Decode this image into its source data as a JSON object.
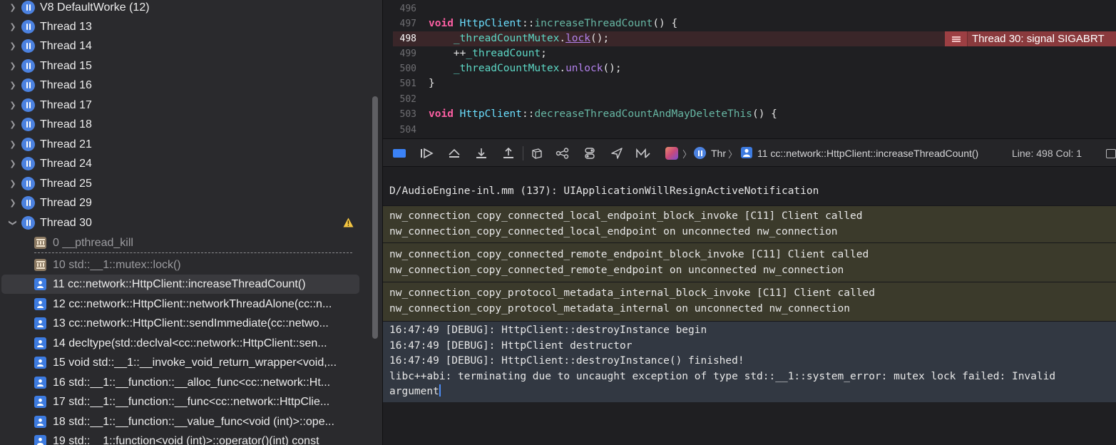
{
  "navigator": {
    "threads": [
      {
        "label": "V8 DefaultWorke (12)"
      },
      {
        "label": "Thread 13"
      },
      {
        "label": "Thread 14"
      },
      {
        "label": "Thread 15"
      },
      {
        "label": "Thread 16"
      },
      {
        "label": "Thread 17"
      },
      {
        "label": "Thread 18"
      },
      {
        "label": "Thread 21"
      },
      {
        "label": "Thread 24"
      },
      {
        "label": "Thread 25"
      },
      {
        "label": "Thread 29"
      },
      {
        "label": "Thread 30",
        "expanded": true,
        "warning": true
      }
    ],
    "frames": [
      {
        "label": "0 __pthread_kill",
        "kind": "system"
      },
      {
        "label": "10 std::__1::mutex::lock()",
        "kind": "system"
      },
      {
        "label": "11 cc::network::HttpClient::increaseThreadCount()",
        "kind": "user",
        "selected": true
      },
      {
        "label": "12 cc::network::HttpClient::networkThreadAlone(cc::n...",
        "kind": "user"
      },
      {
        "label": "13 cc::network::HttpClient::sendImmediate(cc::netwo...",
        "kind": "user"
      },
      {
        "label": "14 decltype(std::declval<cc::network::HttpClient::sen...",
        "kind": "user"
      },
      {
        "label": "15 void std::__1::__invoke_void_return_wrapper<void,...",
        "kind": "user"
      },
      {
        "label": "16 std::__1::__function::__alloc_func<cc::network::Ht...",
        "kind": "user"
      },
      {
        "label": "17 std::__1::__function::__func<cc::network::HttpClie...",
        "kind": "user"
      },
      {
        "label": "18 std::__1::__function::__value_func<void (int)>::ope...",
        "kind": "user"
      },
      {
        "label": "19 std::__1::function<void (int)>::operator()(int) const",
        "kind": "user"
      }
    ]
  },
  "editor": {
    "lines": [
      {
        "num": "496"
      },
      {
        "num": "497",
        "t1": "void",
        "t2": " ",
        "t3": "HttpClient",
        "t4": "::",
        "t5": "increaseThreadCount",
        "t6": "() {"
      },
      {
        "num": "498",
        "t1": "    ",
        "t2": "_threadCountMutex",
        "t3": ".",
        "t4": "lock",
        "t5": "();"
      },
      {
        "num": "499",
        "t1": "    ++",
        "t2": "_threadCount",
        "t3": ";"
      },
      {
        "num": "500",
        "t1": "    ",
        "t2": "_threadCountMutex",
        "t3": ".",
        "t4": "unlock",
        "t5": "();"
      },
      {
        "num": "501",
        "t1": "}"
      },
      {
        "num": "502"
      },
      {
        "num": "503",
        "t1": "void",
        "t2": " ",
        "t3": "HttpClient",
        "t4": "::",
        "t5": "decreaseThreadCountAndMayDeleteThis",
        "t6": "() {"
      },
      {
        "num": "504"
      }
    ],
    "error_badge": "Thread 30: signal SIGABRT"
  },
  "debug_bar": {
    "crumb_thread": "Thr",
    "crumb_frame": "11 cc::network::HttpClient::increaseThreadCount()",
    "crumb_sep": "〉",
    "line_col": "Line: 498  Col: 1",
    "colors": {
      "accent": "#3b82f7"
    }
  },
  "console": {
    "lines": [
      "D/AudioEngine-inl.mm (137): UIApplicationWillResignActiveNotification",
      "nw_connection_copy_connected_local_endpoint_block_invoke [C11] Client called\nnw_connection_copy_connected_local_endpoint on unconnected nw_connection",
      "nw_connection_copy_connected_remote_endpoint_block_invoke [C11] Client called\nnw_connection_copy_connected_remote_endpoint on unconnected nw_connection",
      "nw_connection_copy_protocol_metadata_internal_block_invoke [C11] Client called\nnw_connection_copy_protocol_metadata_internal on unconnected nw_connection",
      "16:47:49 [DEBUG]: HttpClient::destroyInstance begin\n16:47:49 [DEBUG]: HttpClient destructor\n16:47:49 [DEBUG]: HttpClient::destroyInstance() finished!\nlibc++abi: terminating due to uncaught exception of type std::__1::system_error: mutex lock failed: Invalid\nargument"
    ]
  }
}
